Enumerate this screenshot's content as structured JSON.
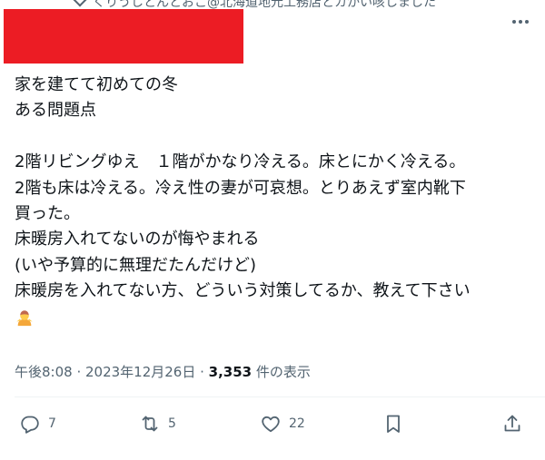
{
  "header": {
    "repost_text": "くりうしとんとおこ@北海道地元工務店とカかい咳しました"
  },
  "body": {
    "lines": [
      "家を建てて初めての冬",
      "ある問題点",
      "",
      "2階リビングゆえ　１階がかなり冷える。床とにかく冷える。",
      "2階も床は冷える。冷え性の妻が可哀想。とりあえず室内靴下",
      "買った。",
      "床暖房入れてないのが悔やまれる",
      "(いや予算的に無理だたんだけど)",
      "床暖房を入れてない方、どういう対策してるか、教えて下さい"
    ],
    "emoji_icon": "person-bowing-icon"
  },
  "meta": {
    "timestamp": "午後8:08 · 2023年12月26日",
    "separator": " · ",
    "views_count": "3,353",
    "views_label": " 件の表示"
  },
  "actions": {
    "replies": "7",
    "reposts": "5",
    "likes": "22"
  },
  "colors": {
    "redaction": "#ec1c24",
    "secondary_text": "#536471",
    "primary_text": "#0f1419"
  }
}
